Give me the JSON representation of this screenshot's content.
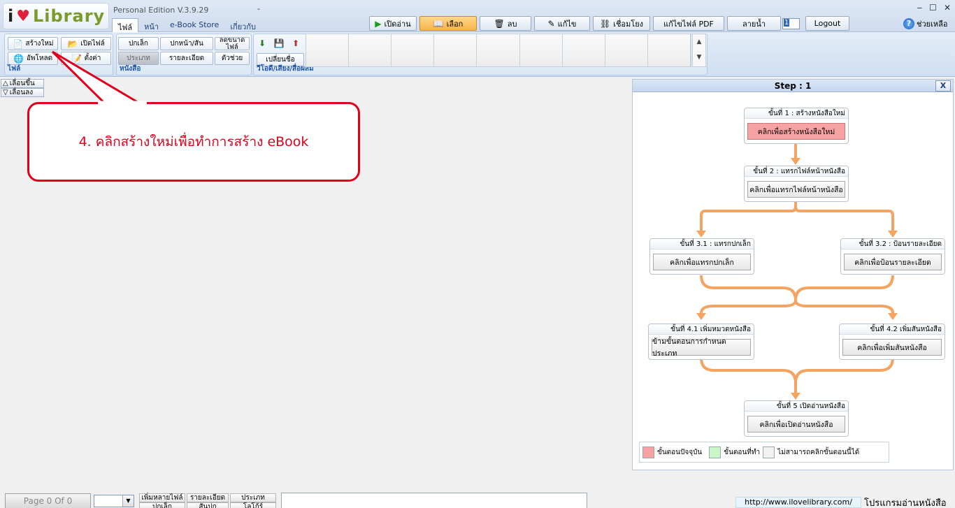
{
  "app": {
    "logo_i": "i",
    "logo_heart": "♥",
    "logo_text": "Library",
    "edition": "Personal Edition V.3.9.29",
    "dash": "-"
  },
  "menu_tabs": [
    "ไฟล์",
    "หน้า",
    "e-Book Store",
    "เกี่ยวกับ"
  ],
  "toolbar": {
    "open_read": "เปิดอ่าน",
    "select": "เลือก",
    "delete": "ลบ",
    "edit": "แก้ไข",
    "link": "เชื่อมโยง",
    "edit_pdf": "แก้ไขไฟล์ PDF",
    "watermark": "ลายน้ำ",
    "number_value": "1",
    "logout": "Logout",
    "help": "ช่วยเหลือ"
  },
  "window_controls": {
    "minimize": "‒",
    "maximize": "☐",
    "close": "✕"
  },
  "ribbon": {
    "file_group": {
      "label": "ไฟล์",
      "new": "สร้างใหม่",
      "open_file": "เปิดไฟล์",
      "upload": "อัพโหลด",
      "settings": "ตั้งค่า"
    },
    "book_group": {
      "label": "หนังสือ",
      "front_cover": "ปกเล็ก",
      "cover_spine": "ปกหน้า/สัน",
      "reduce_size": "ลดขนาดไฟล์",
      "category": "ประเภท",
      "details": "รายละเอียด",
      "helper": "ตัวช่วย"
    },
    "media_group": {
      "label": "วีโอดี/เสียง/สื่อผสม",
      "rename": "เปลี่ยนชื่อ"
    }
  },
  "side_buttons": {
    "move_up": "เลื่อนขึ้น",
    "move_down": "เลื่อนลง"
  },
  "callout": {
    "text": "4. คลิกสร้างใหม่เพื่อทำการสร้าง eBook"
  },
  "step_panel": {
    "title": "Step : 1",
    "close": "X",
    "steps": [
      {
        "title": "ขั้นที่ 1 : สร้างหนังสือใหม่",
        "button": "คลิกเพื่อสร้างหนังสือใหม่"
      },
      {
        "title": "ขั้นที่ 2 : แทรกไฟล์หน้าหนังสือ",
        "button": "คลิกเพื่อแทรกไฟล์หน้าหนังสือ"
      },
      {
        "title": "ขั้นที่ 3.1 : แทรกปกเล็ก",
        "button": "คลิกเพื่อแทรกปกเล็ก"
      },
      {
        "title": "ขั้นที่ 3.2 : ป้อนรายละเอียด",
        "button": "คลิกเพื่อป้อนรายละเอียด"
      },
      {
        "title": "ขั้นที่ 4.1 เพิ่มหมวดหนังสือ",
        "button": "ข้ามขั้นตอนการกำหนดประเภท"
      },
      {
        "title": "ขั้นที่ 4.2 เพิ่มสันหนังสือ",
        "button": "คลิกเพื่อเพิ่มสันหนังสือ"
      },
      {
        "title": "ขั้นที่ 5 เปิดอ่านหนังสือ",
        "button": "คลิกเพื่อเปิดอ่านหนังสือ"
      }
    ],
    "legend": {
      "current": "ขั้นตอนปัจจุบัน",
      "done": "ขั้นตอนที่ทำ",
      "disabled": "ไม่สามารถคลิกขั้นตอนนี้ได้"
    },
    "colors": {
      "current": "#f8a3a3",
      "done": "#c9f5c9",
      "disabled": "#f2f2f2",
      "flow": "#f4a460"
    }
  },
  "bottom": {
    "page": "Page 0 Of 0",
    "add_many": "เพิ่มหลายไฟล์",
    "details": "รายละเอียด",
    "category": "ประเภท",
    "small_cover": "ปกเล็ก",
    "spine": "สันปก",
    "logo": "โลโก้ร์",
    "url": "http://www.ilovelibrary.com/",
    "program": "โปรแกรมอ่านหนังสือ"
  }
}
